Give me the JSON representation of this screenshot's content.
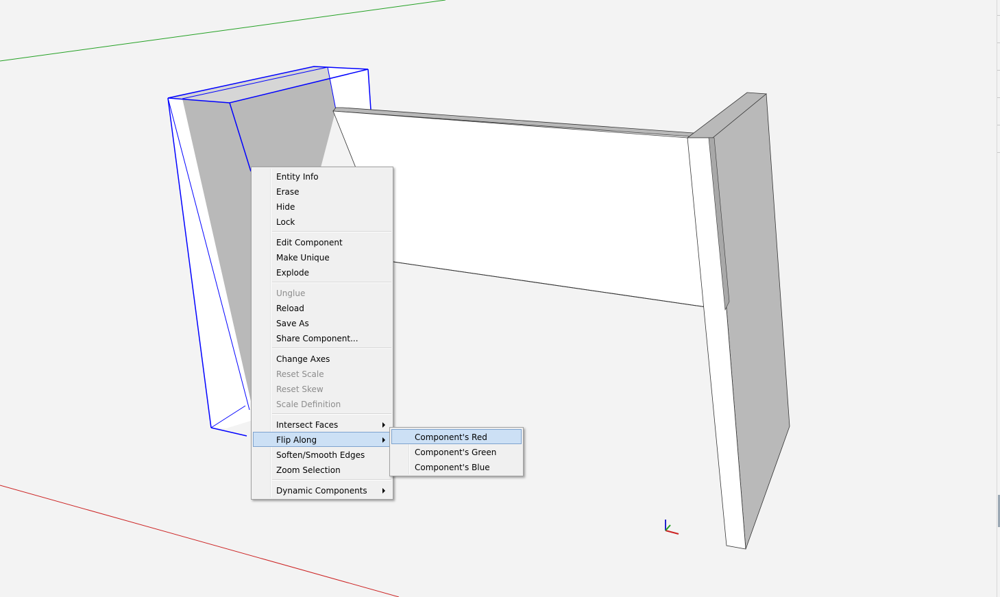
{
  "context_menu": {
    "groups": [
      [
        {
          "label": "Entity Info",
          "enabled": true
        },
        {
          "label": "Erase",
          "enabled": true
        },
        {
          "label": "Hide",
          "enabled": true
        },
        {
          "label": "Lock",
          "enabled": true
        }
      ],
      [
        {
          "label": "Edit Component",
          "enabled": true
        },
        {
          "label": "Make Unique",
          "enabled": true
        },
        {
          "label": "Explode",
          "enabled": true
        }
      ],
      [
        {
          "label": "Unglue",
          "enabled": false
        },
        {
          "label": "Reload",
          "enabled": true
        },
        {
          "label": "Save As",
          "enabled": true
        },
        {
          "label": "Share Component...",
          "enabled": true
        }
      ],
      [
        {
          "label": "Change Axes",
          "enabled": true
        },
        {
          "label": "Reset Scale",
          "enabled": false
        },
        {
          "label": "Reset Skew",
          "enabled": false
        },
        {
          "label": "Scale Definition",
          "enabled": false
        }
      ],
      [
        {
          "label": "Intersect Faces",
          "enabled": true,
          "submenu": true
        },
        {
          "label": "Flip Along",
          "enabled": true,
          "submenu": true,
          "highlighted": true
        },
        {
          "label": "Soften/Smooth Edges",
          "enabled": true
        },
        {
          "label": "Zoom Selection",
          "enabled": true
        }
      ],
      [
        {
          "label": "Dynamic Components",
          "enabled": true,
          "submenu": true
        }
      ]
    ]
  },
  "flip_submenu": {
    "items": [
      {
        "label": "Component's Red",
        "highlighted": true
      },
      {
        "label": "Component's Green",
        "highlighted": false
      },
      {
        "label": "Component's Blue",
        "highlighted": false
      }
    ]
  },
  "colors": {
    "background": "#f3f3f3",
    "selection": "#0000ff",
    "red_axis": "#cc2222",
    "green_axis": "#22a022",
    "blue_axis": "#2222cc",
    "face_front": "#ffffff",
    "face_shaded": "#b9b9b9",
    "menu_highlight": "#cce0f5"
  }
}
